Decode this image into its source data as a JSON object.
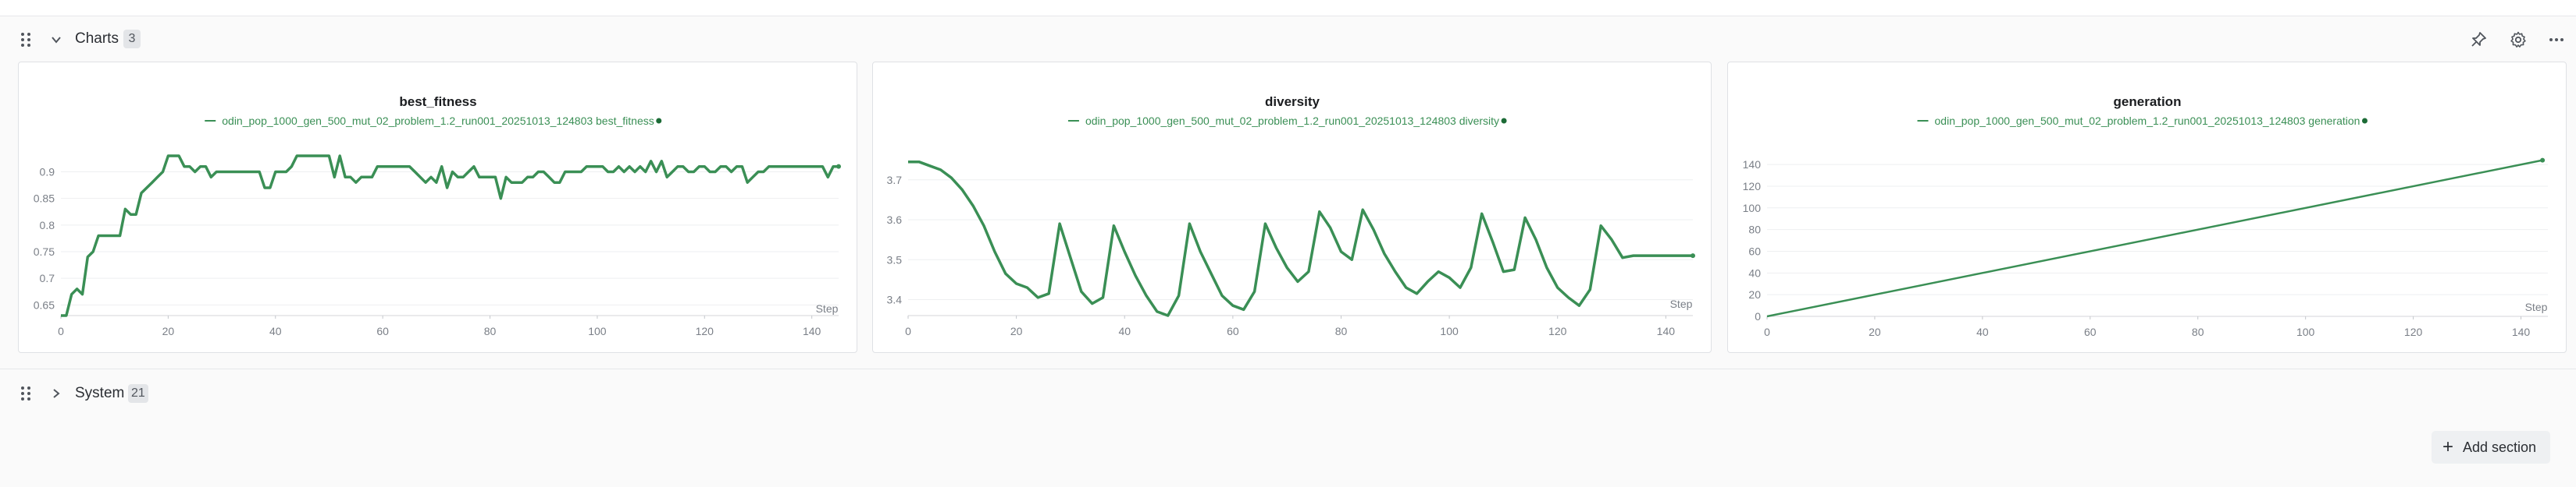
{
  "sections": {
    "charts": {
      "title": "Charts",
      "count": "3",
      "expanded": true
    },
    "system": {
      "title": "System",
      "count": "21",
      "expanded": false
    }
  },
  "header_icons": [
    "pin-icon",
    "gear-icon",
    "more-icon"
  ],
  "add_section": {
    "label": "Add section"
  },
  "colors": {
    "series": "#3a8f55",
    "grid": "#eeeff1",
    "tick": "#7a7f87"
  },
  "chart_data": [
    {
      "type": "line",
      "title": "best_fitness",
      "legend": "odin_pop_1000_gen_500_mut_02_problem_1.2_run001_20251013_124803 best_fitness",
      "xlabel": "Step",
      "xlim": [
        0,
        145
      ],
      "ylim": [
        0.63,
        0.93
      ],
      "xticks": [
        0,
        20,
        40,
        60,
        80,
        100,
        120,
        140
      ],
      "yticks": [
        0.65,
        0.7,
        0.75,
        0.8,
        0.85,
        0.9
      ],
      "ytick_labels": [
        "0.65",
        "0.7",
        "0.75",
        "0.8",
        "0.85",
        "0.9"
      ],
      "series": [
        {
          "x": [
            0,
            1,
            2,
            3,
            4,
            5,
            6,
            7,
            8,
            9,
            10,
            11,
            12,
            13,
            14,
            15,
            16,
            17,
            18,
            19,
            20,
            21,
            22,
            23,
            24,
            25,
            26,
            27,
            28,
            29,
            30,
            31,
            32,
            33,
            34,
            35,
            36,
            37,
            38,
            39,
            40,
            41,
            42,
            43,
            44,
            45,
            46,
            47,
            48,
            49,
            50,
            51,
            52,
            53,
            54,
            55,
            56,
            57,
            58,
            59,
            60,
            61,
            62,
            63,
            64,
            65,
            66,
            67,
            68,
            69,
            70,
            71,
            72,
            73,
            74,
            75,
            76,
            77,
            78,
            79,
            80,
            81,
            82,
            83,
            84,
            85,
            86,
            87,
            88,
            89,
            90,
            91,
            92,
            93,
            94,
            95,
            96,
            97,
            98,
            99,
            100,
            101,
            102,
            103,
            104,
            105,
            106,
            107,
            108,
            109,
            110,
            111,
            112,
            113,
            114,
            115,
            116,
            117,
            118,
            119,
            120,
            121,
            122,
            123,
            124,
            125,
            126,
            127,
            128,
            129,
            130,
            131,
            132,
            133,
            134,
            135,
            136,
            137,
            138,
            139,
            140,
            141,
            142,
            143,
            144,
            145
          ],
          "y": [
            0.63,
            0.63,
            0.67,
            0.68,
            0.67,
            0.74,
            0.75,
            0.78,
            0.78,
            0.78,
            0.78,
            0.78,
            0.83,
            0.82,
            0.82,
            0.86,
            0.87,
            0.88,
            0.89,
            0.9,
            0.93,
            0.93,
            0.93,
            0.91,
            0.91,
            0.9,
            0.91,
            0.91,
            0.89,
            0.9,
            0.9,
            0.9,
            0.9,
            0.9,
            0.9,
            0.9,
            0.9,
            0.9,
            0.87,
            0.87,
            0.9,
            0.9,
            0.9,
            0.91,
            0.93,
            0.93,
            0.93,
            0.93,
            0.93,
            0.93,
            0.93,
            0.89,
            0.93,
            0.89,
            0.89,
            0.88,
            0.89,
            0.89,
            0.89,
            0.91,
            0.91,
            0.91,
            0.91,
            0.91,
            0.91,
            0.91,
            0.9,
            0.89,
            0.88,
            0.89,
            0.88,
            0.91,
            0.87,
            0.9,
            0.89,
            0.89,
            0.9,
            0.91,
            0.89,
            0.89,
            0.89,
            0.89,
            0.85,
            0.89,
            0.88,
            0.88,
            0.88,
            0.89,
            0.89,
            0.9,
            0.9,
            0.89,
            0.88,
            0.88,
            0.9,
            0.9,
            0.9,
            0.9,
            0.91,
            0.91,
            0.91,
            0.91,
            0.9,
            0.9,
            0.91,
            0.9,
            0.91,
            0.9,
            0.91,
            0.9,
            0.92,
            0.9,
            0.92,
            0.89,
            0.9,
            0.91,
            0.91,
            0.9,
            0.9,
            0.91,
            0.91,
            0.9,
            0.9,
            0.91,
            0.91,
            0.9,
            0.91,
            0.91,
            0.88,
            0.89,
            0.9,
            0.9,
            0.91,
            0.91,
            0.91,
            0.91,
            0.91,
            0.91,
            0.91,
            0.91,
            0.91,
            0.91,
            0.91,
            0.89,
            0.91,
            0.91
          ]
        }
      ]
    },
    {
      "type": "line",
      "title": "diversity",
      "legend": "odin_pop_1000_gen_500_mut_02_problem_1.2_run001_20251013_124803 diversity",
      "xlabel": "Step",
      "xlim": [
        0,
        145
      ],
      "ylim": [
        3.36,
        3.76
      ],
      "xticks": [
        0,
        20,
        40,
        60,
        80,
        100,
        120,
        140
      ],
      "yticks": [
        3.4,
        3.5,
        3.6,
        3.7
      ],
      "ytick_labels": [
        "3.4",
        "3.5",
        "3.6",
        "3.7"
      ],
      "series": [
        {
          "x": [
            0,
            2,
            4,
            6,
            8,
            10,
            12,
            14,
            16,
            18,
            20,
            22,
            24,
            26,
            28,
            30,
            32,
            34,
            36,
            38,
            40,
            42,
            44,
            46,
            48,
            50,
            52,
            54,
            56,
            58,
            60,
            62,
            64,
            66,
            68,
            70,
            72,
            74,
            76,
            78,
            80,
            82,
            84,
            86,
            88,
            90,
            92,
            94,
            96,
            98,
            100,
            102,
            104,
            106,
            108,
            110,
            112,
            114,
            116,
            118,
            120,
            122,
            124,
            126,
            128,
            130,
            132,
            134,
            136,
            138,
            140,
            142,
            144,
            145
          ],
          "y": [
            3.745,
            3.745,
            3.735,
            3.725,
            3.705,
            3.675,
            3.635,
            3.585,
            3.52,
            3.465,
            3.44,
            3.43,
            3.405,
            3.415,
            3.59,
            3.505,
            3.42,
            3.39,
            3.405,
            3.585,
            3.52,
            3.46,
            3.41,
            3.37,
            3.36,
            3.41,
            3.59,
            3.52,
            3.465,
            3.41,
            3.385,
            3.375,
            3.42,
            3.59,
            3.53,
            3.48,
            3.445,
            3.47,
            3.62,
            3.58,
            3.52,
            3.5,
            3.625,
            3.575,
            3.515,
            3.47,
            3.43,
            3.415,
            3.445,
            3.47,
            3.455,
            3.43,
            3.48,
            3.615,
            3.545,
            3.47,
            3.475,
            3.605,
            3.55,
            3.48,
            3.43,
            3.405,
            3.385,
            3.425,
            3.585,
            3.55,
            3.505,
            3.51,
            3.51,
            3.51,
            3.51,
            3.51,
            3.51,
            3.51
          ]
        }
      ]
    },
    {
      "type": "line",
      "title": "generation",
      "legend": "odin_pop_1000_gen_500_mut_02_problem_1.2_run001_20251013_124803 generation",
      "xlabel": "Step",
      "xlim": [
        0,
        145
      ],
      "ylim": [
        0,
        148
      ],
      "xticks": [
        0,
        20,
        40,
        60,
        80,
        100,
        120,
        140
      ],
      "yticks": [
        0,
        20,
        40,
        60,
        80,
        100,
        120,
        140
      ],
      "ytick_labels": [
        "0",
        "20",
        "40",
        "60",
        "80",
        "100",
        "120",
        "140"
      ],
      "series": [
        {
          "x": [
            0,
            144
          ],
          "y": [
            0,
            144
          ]
        }
      ]
    }
  ]
}
